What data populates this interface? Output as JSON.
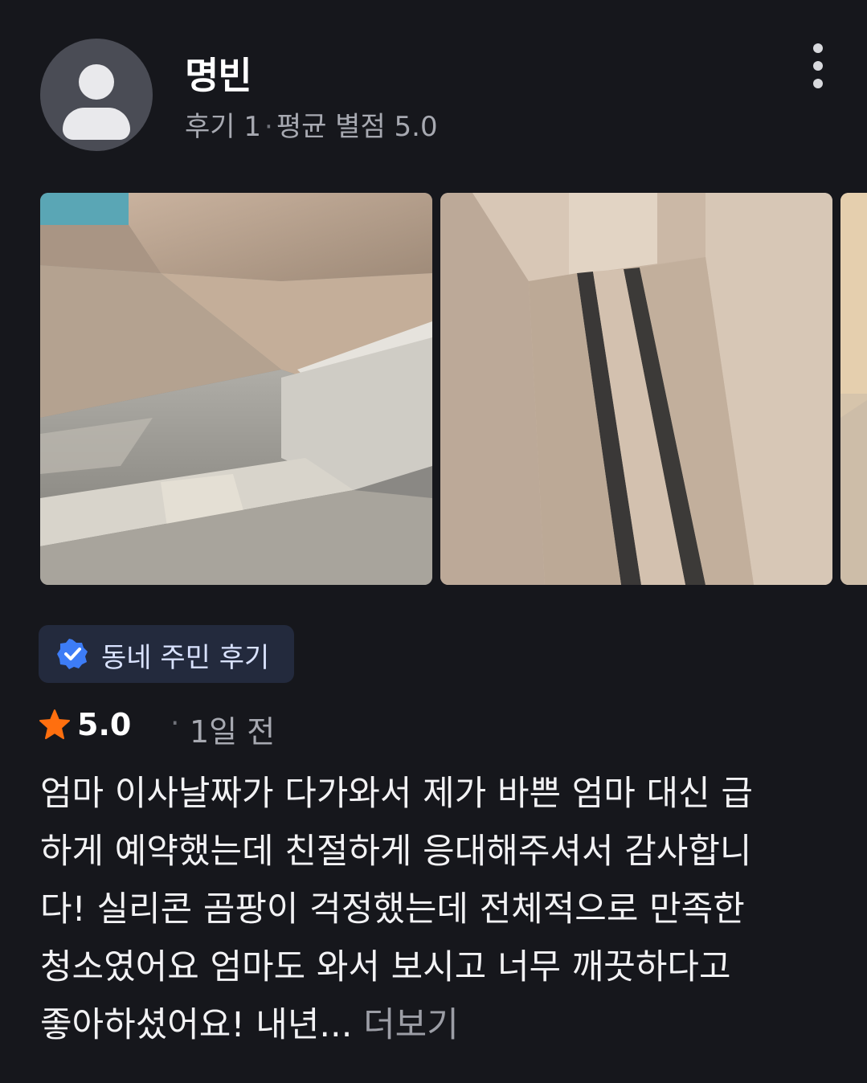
{
  "reviewer": {
    "name": "명빈",
    "review_count_label": "후기 1",
    "average_rating_label": "평균 별점 5.0"
  },
  "badge": {
    "label": "동네 주민 후기",
    "icon": "verified-check-icon",
    "color": "#3d7cf6"
  },
  "rating": {
    "score": "5.0",
    "time_ago": "1일 전",
    "star_color": "#ff6f0f"
  },
  "review": {
    "lines": [
      "엄마 이사날짜가 다가와서 제가 바쁜 엄마 대신 급",
      "하게 예약했는데 친절하게 응대해주셔서 감사합니",
      "다! 실리콘 곰팡이 걱정했는데 전체적으로 만족한",
      "청소였어요 엄마도 와서 보시고 너무 깨끗하다고",
      "좋아하셨어요! 내년..."
    ],
    "more_label": "더보기"
  },
  "colors": {
    "background": "#16171c",
    "text_secondary": "#a7a9b1"
  }
}
